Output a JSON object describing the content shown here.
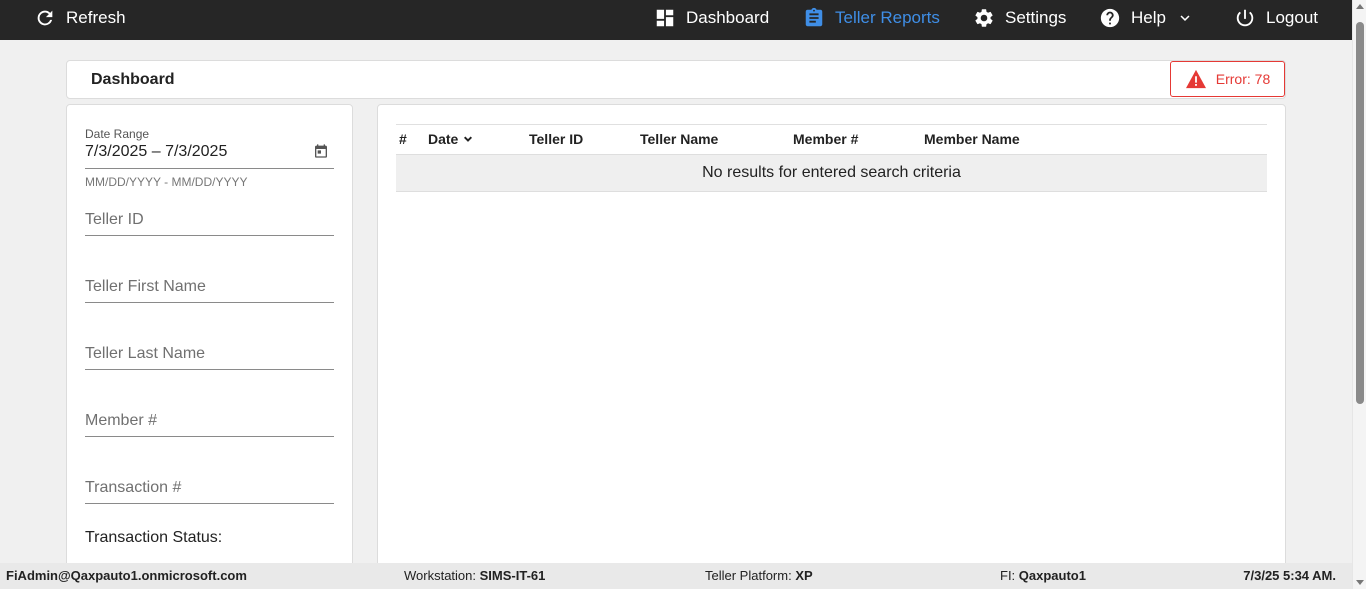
{
  "topbar": {
    "refresh": "Refresh",
    "dashboard": "Dashboard",
    "teller_reports": "Teller Reports",
    "settings": "Settings",
    "help": "Help",
    "logout": "Logout",
    "active_color": "#3f8ee6"
  },
  "header": {
    "title": "Dashboard",
    "error_label": "Error: 78",
    "error_color": "#e53935"
  },
  "filters": {
    "date_range_label": "Date Range",
    "date_range_value": "7/3/2025 – 7/3/2025",
    "date_hint": "MM/DD/YYYY - MM/DD/YYYY",
    "teller_id_placeholder": "Teller ID",
    "teller_first_name_placeholder": "Teller First Name",
    "teller_last_name_placeholder": "Teller Last Name",
    "member_number_placeholder": "Member #",
    "transaction_number_placeholder": "Transaction #",
    "transaction_status_label": "Transaction Status:"
  },
  "table": {
    "columns": [
      "#",
      "Date",
      "Teller ID",
      "Teller Name",
      "Member #",
      "Member Name"
    ],
    "sorted_column": "Date",
    "sort_direction": "descending",
    "empty_message": "No results for entered search criteria"
  },
  "statusbar": {
    "user": "FiAdmin@Qaxpauto1.onmicrosoft.com",
    "workstation_label": "Workstation:",
    "workstation_value": "SIMS-IT-61",
    "platform_label": "Teller Platform:",
    "platform_value": "XP",
    "fi_label": "FI:",
    "fi_value": "Qaxpauto1",
    "datetime": "7/3/25 5:34 AM."
  }
}
